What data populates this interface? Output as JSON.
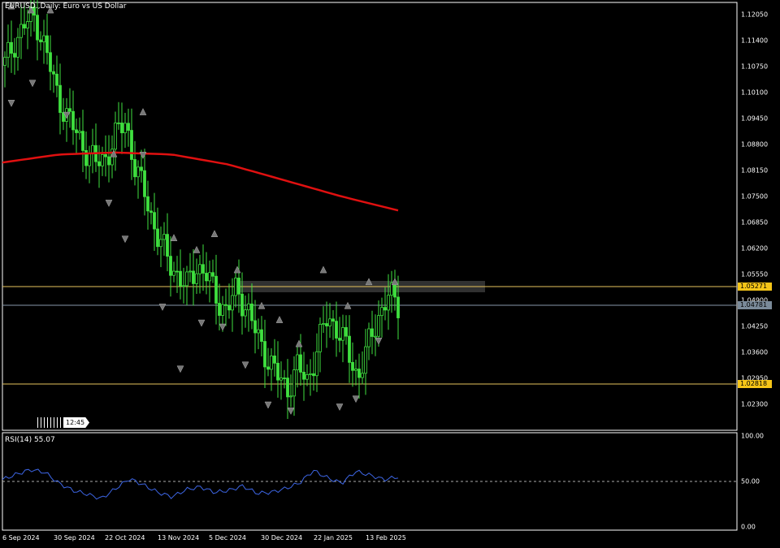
{
  "chart": {
    "title": "EURUSD.,Daily:  Euro vs US Dollar",
    "background": "#000000",
    "candle_color": "#3fe03f",
    "ma_color": "#e01010",
    "rsi_color": "#3d66e6",
    "level_color": "#e6c35c",
    "zone_color": "#3a3a3a",
    "price_axis": {
      "ticks": [
        "1.12050",
        "1.11400",
        "1.10750",
        "1.10100",
        "1.09450",
        "1.08800",
        "1.08150",
        "1.07500",
        "1.06850",
        "1.06200",
        "1.05550",
        "1.04900",
        "1.04250",
        "1.03600",
        "1.02950",
        "1.02300"
      ],
      "min": 1.019,
      "max": 1.1235
    },
    "levels": {
      "resistance": "1.05271",
      "current": "1.04781",
      "support": "1.02818"
    },
    "date_axis": [
      "6 Sep 2024",
      "30 Sep 2024",
      "22 Oct 2024",
      "13 Nov 2024",
      "5 Dec 2024",
      "30 Dec 2024",
      "22 Jan 2025",
      "13 Feb 2025"
    ],
    "timer": "12:45",
    "rsi": {
      "title": "RSI(14) 55.07",
      "ticks": [
        "100.00",
        "50.00",
        "0.00"
      ]
    }
  },
  "chart_data": [
    {
      "type": "candlestick",
      "title": "EURUSD.,Daily:  Euro vs US Dollar",
      "x": [
        "6 Sep 2024",
        "30 Sep 2024",
        "22 Oct 2024",
        "13 Nov 2024",
        "5 Dec 2024",
        "30 Dec 2024",
        "22 Jan 2025",
        "13 Feb 2025"
      ],
      "close_path": [
        1.108,
        1.114,
        1.118,
        1.12,
        1.112,
        1.102,
        1.096,
        1.091,
        1.087,
        1.083,
        1.085,
        1.09,
        1.094,
        1.081,
        1.075,
        1.066,
        1.06,
        1.056,
        1.052,
        1.058,
        1.055,
        1.05,
        1.046,
        1.052,
        1.047,
        1.04,
        1.035,
        1.03,
        1.027,
        1.032,
        1.029,
        1.037,
        1.045,
        1.042,
        1.036,
        1.03,
        1.037,
        1.045,
        1.05,
        1.048
      ],
      "moving_average": [
        1.0835,
        1.0855,
        1.086,
        1.0855,
        1.083,
        1.079,
        1.075,
        1.0715
      ],
      "ylim": [
        1.019,
        1.1235
      ]
    },
    {
      "type": "line",
      "title": "RSI(14) 55.07",
      "values": [
        52,
        58,
        63,
        60,
        48,
        40,
        36,
        31,
        42,
        53,
        46,
        38,
        33,
        41,
        44,
        38,
        40,
        45,
        37,
        38,
        42,
        48,
        62,
        54,
        48,
        61,
        57,
        52,
        55
      ],
      "ylim": [
        0,
        100
      ]
    }
  ]
}
